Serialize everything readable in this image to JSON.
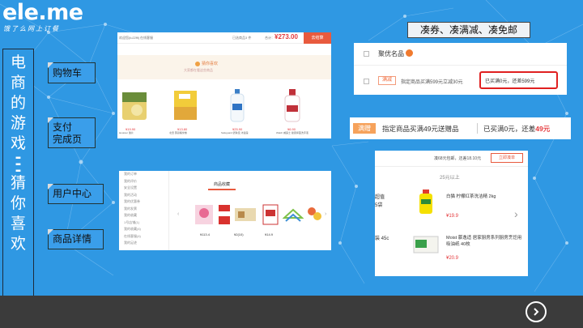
{
  "logo": {
    "brand": "ele.me",
    "slogan": "饿了么网上订餐"
  },
  "vertical_title": [
    "电",
    "商",
    "的",
    "游",
    "戏",
    "-",
    "-",
    "-",
    "猜",
    "你",
    "喜",
    "欢"
  ],
  "labels": {
    "cart": "购物车",
    "pay_line1": "支付",
    "pay_line2": "完成页",
    "user_center": "用户中心",
    "product_detail": "商品详情"
  },
  "promo_heading": "凑券、凑满减、凑免邮",
  "cart_shot": {
    "header_left_a": "欢迎您(lu22ffl)",
    "header_left_b": "在线客服",
    "selected_text": "已选商品3 件",
    "total_label": "合计：",
    "total_value": "¥273.00",
    "checkout": "去结算",
    "banner_title": "猜你喜欢",
    "banner_sub": "大家都在看这些商品",
    "products": [
      {
        "price": "¥19.90",
        "name": "lavoisier 薯片"
      },
      {
        "price": "¥13.80",
        "name": "北田 蒟蒻糙米卷"
      },
      {
        "price": "¥25.90",
        "name": "Safeguard 舒肤佳 沐浴露"
      },
      {
        "price": "¥6.90",
        "name": "Walch 威露士 健康抑菌洗手液"
      }
    ]
  },
  "coupon_shot": {
    "store": "聚优名品",
    "tag": "满减",
    "desc": "指定商品买满599元立减30元",
    "status": "已买满0元，还差599元"
  },
  "gift_bar": {
    "tag": "满赠",
    "desc": "指定商品买满49元送赠品",
    "status_a": "已买满0元，还差",
    "status_b": "49元"
  },
  "user_shot": {
    "menu": [
      "我的订单",
      "我的评价",
      "安全设置",
      "我的活动",
      "我的优惠券",
      "我的发票",
      "我的收藏",
      "1号店铺(1)",
      "我的收藏(4)",
      "在线客服(4)",
      "我的足迹"
    ],
    "section_title": "商品收藏",
    "prices": [
      "¥113.4",
      "¥2(10)",
      "¥14.9"
    ]
  },
  "detail_shot": {
    "header_text": "凑68元包邮，还差18.10元",
    "header_btn": "立即凑单",
    "section": "25元以上",
    "left_text_a": "超值",
    "left_text_b": "5袋",
    "left_text_c": "装 45c",
    "items": [
      {
        "name": "白猫 柠檬红茶洗洁精 2kg",
        "price": "¥19.9"
      },
      {
        "name": "Moist 慕逸适 居家厨房系列厨房烹饪用吸油纸 40枚",
        "price": "¥20.9"
      }
    ]
  }
}
